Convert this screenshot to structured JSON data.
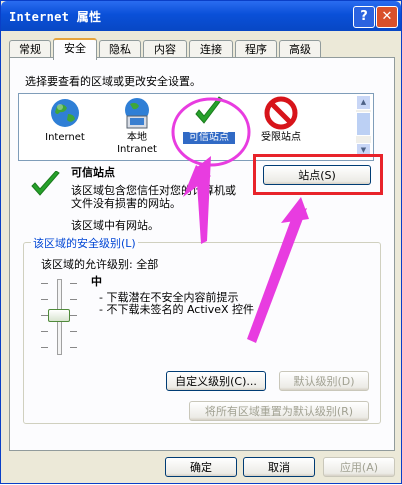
{
  "window": {
    "title": "Internet 属性",
    "help_label": "?",
    "close_label": "✕"
  },
  "tabs": [
    {
      "label": "常规"
    },
    {
      "label": "安全"
    },
    {
      "label": "隐私"
    },
    {
      "label": "内容"
    },
    {
      "label": "连接"
    },
    {
      "label": "程序"
    },
    {
      "label": "高级"
    }
  ],
  "security": {
    "instruction": "选择要查看的区域或更改安全设置。",
    "zones": [
      {
        "label": "Internet",
        "icon": "globe-icon"
      },
      {
        "label": "本地\nIntranet",
        "icon": "intranet-globe-icon"
      },
      {
        "label": "可信站点",
        "icon": "green-check-icon"
      },
      {
        "label": "受限站点",
        "icon": "no-entry-icon"
      }
    ],
    "selected_zone_title": "可信站点",
    "description_line1": "该区域包含您信任对您的计算机或",
    "description_line2": "文件没有损害的网站。",
    "sites_note": "该区域中有网站。",
    "sites_button": "站点(S)",
    "level_group_title": "该区域的安全级别(L)",
    "allowed_levels": "该区域的允许级别: 全部",
    "level_name": "中",
    "level_bullet1": "- 下载潜在不安全内容前提示",
    "level_bullet2": "- 不下载未签名的 ActiveX 控件",
    "custom_level_button": "自定义级别(C)...",
    "default_level_button": "默认级别(D)",
    "reset_all_button": "将所有区域重置为默认级别(R)"
  },
  "footer": {
    "ok_label": "确定",
    "cancel_label": "取消",
    "apply_label": "应用(A)"
  },
  "colors": {
    "title_bar": "#0a50d8",
    "annotation_red": "#e8232a",
    "annotation_magenta": "#e83ce0",
    "link_blue": "#0046d5"
  }
}
